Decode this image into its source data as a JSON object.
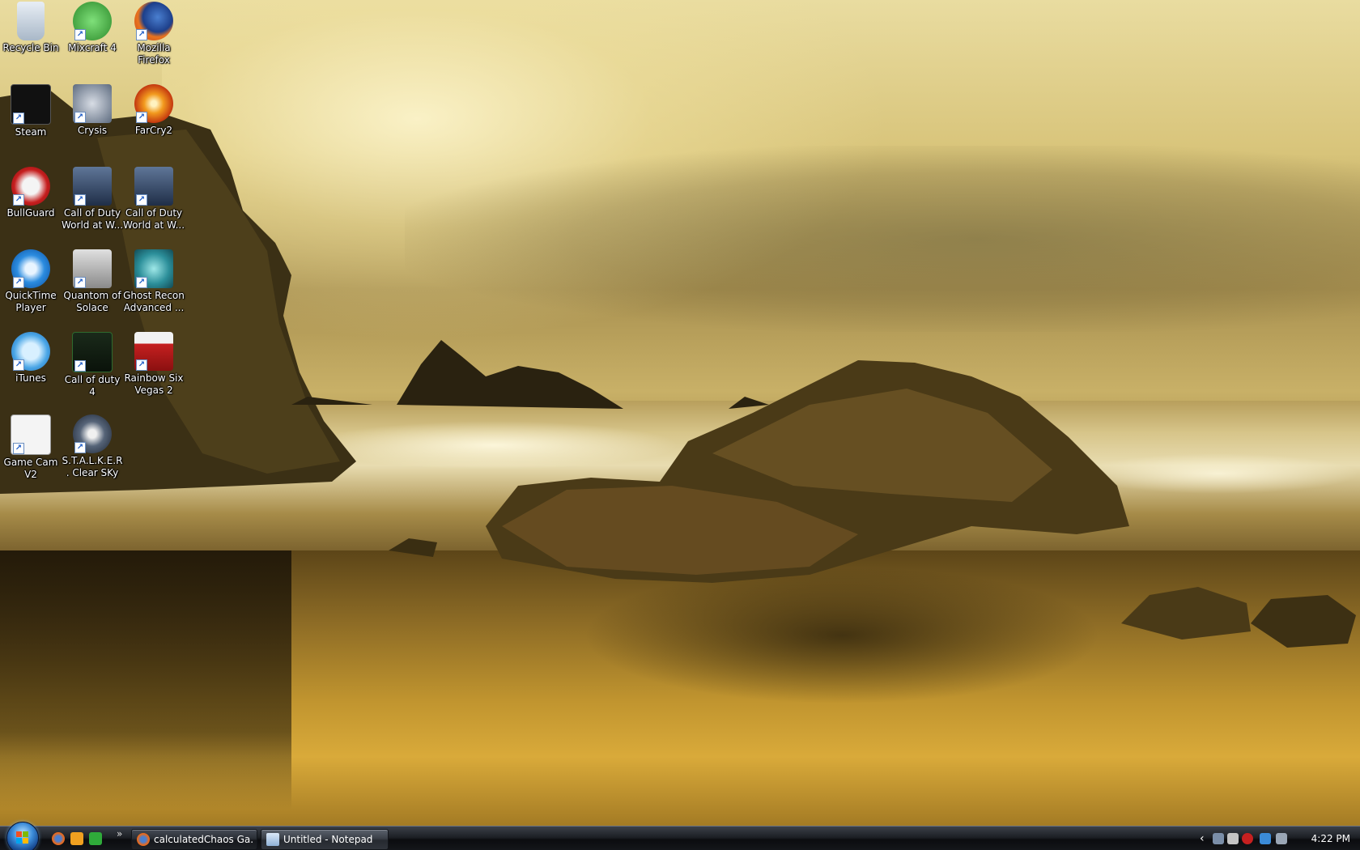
{
  "desktop": {
    "icons": [
      {
        "id": "recycle-bin",
        "label": "Recycle Bin",
        "icon": "recycle-bin-icon",
        "shortcut": false
      },
      {
        "id": "mixcraft",
        "label": "Mixcraft 4",
        "icon": "mixcraft-icon",
        "shortcut": true
      },
      {
        "id": "firefox",
        "label": "Mozilla Firefox",
        "icon": "firefox-icon",
        "shortcut": true
      },
      {
        "id": "steam",
        "label": "Steam",
        "icon": "steam-icon",
        "shortcut": true
      },
      {
        "id": "crysis",
        "label": "Crysis",
        "icon": "crysis-icon",
        "shortcut": true
      },
      {
        "id": "farcry2",
        "label": "FarCry2",
        "icon": "farcry2-icon",
        "shortcut": true
      },
      {
        "id": "bullguard",
        "label": "BullGuard",
        "icon": "bullguard-icon",
        "shortcut": true
      },
      {
        "id": "cod-waw-1",
        "label": "Call of Duty World at W...",
        "icon": "call-of-duty-waw-icon",
        "shortcut": true
      },
      {
        "id": "cod-waw-2",
        "label": "Call of Duty World at W...",
        "icon": "call-of-duty-waw-icon",
        "shortcut": true
      },
      {
        "id": "quicktime",
        "label": "QuickTime Player",
        "icon": "quicktime-icon",
        "shortcut": true
      },
      {
        "id": "quantum",
        "label": "Quantom of Solace",
        "icon": "quantum-of-solace-icon",
        "shortcut": true
      },
      {
        "id": "ghost-recon",
        "label": "Ghost Recon Advanced ...",
        "icon": "ghost-recon-icon",
        "shortcut": true
      },
      {
        "id": "itunes",
        "label": "iTunes",
        "icon": "itunes-icon",
        "shortcut": true
      },
      {
        "id": "cod4",
        "label": "Call of duty 4",
        "icon": "call-of-duty-4-icon",
        "shortcut": true
      },
      {
        "id": "vegas2",
        "label": "Rainbow Six Vegas 2",
        "icon": "rainbow-six-vegas-icon",
        "shortcut": true
      },
      {
        "id": "gamecam",
        "label": "Game Cam V2",
        "icon": "game-cam-icon",
        "shortcut": true
      },
      {
        "id": "stalker",
        "label": "S.T.A.L.K.E.R. Clear SKy",
        "icon": "stalker-icon",
        "shortcut": true
      }
    ]
  },
  "taskbar": {
    "quick_launch": [
      {
        "icon": "firefox-icon",
        "color": "#e66a1f"
      },
      {
        "icon": "media-player-icon",
        "color": "#f0a020"
      },
      {
        "icon": "app-green-icon",
        "color": "#2faa3a"
      }
    ],
    "overflow_glyph": "»",
    "tasks": [
      {
        "label": "calculatedChaos Ga...",
        "icon": "firefox-icon",
        "active": true
      },
      {
        "label": "Untitled - Notepad",
        "icon": "notepad-icon",
        "active": false
      }
    ],
    "tray": {
      "expand_glyph": "‹",
      "clock": "4:22 PM"
    }
  },
  "colors": {
    "taskbar_bg": "#1c1f24",
    "label_text": "#ffffff",
    "accent_blue": "#3b8bd8"
  }
}
